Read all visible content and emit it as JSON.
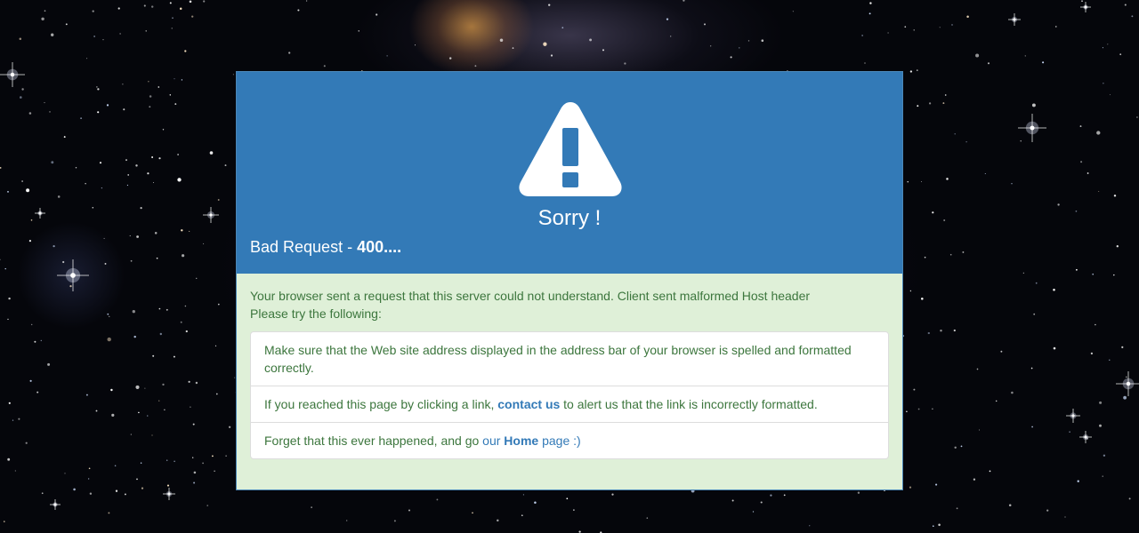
{
  "heading": {
    "icon": "warning-triangle-icon",
    "title": "Sorry !",
    "error_label": "Bad Request - ",
    "error_code": "400...."
  },
  "body": {
    "message": "Your browser sent a request that this server could not understand. Client sent malformed Host header",
    "instruction": "Please try the following:",
    "items": {
      "item1": "Make sure that the Web site address displayed in the address bar of your browser is spelled and formatted correctly.",
      "item2_prefix": "If you reached this page by clicking a link, ",
      "item2_link": "contact us",
      "item2_suffix": " to alert us that the link is incorrectly formatted.",
      "item3_prefix": "Forget that this ever happened, and go ",
      "item3_link_pre": "our ",
      "item3_link_bold": "Home",
      "item3_link_post": " page :)"
    }
  },
  "colors": {
    "header_bg": "#337ab7",
    "body_bg": "#dff0d8",
    "body_text": "#3c763d",
    "link": "#337ab7"
  }
}
